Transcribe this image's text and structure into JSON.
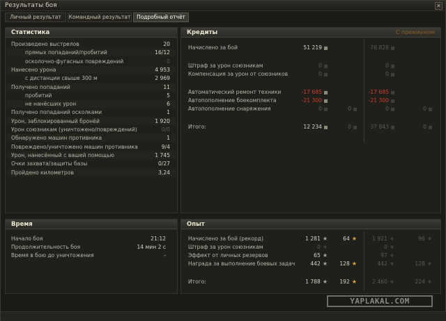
{
  "window": {
    "title": "Результаты боя",
    "close_icon": "close-icon"
  },
  "tabs": [
    {
      "label": "Личный результат",
      "active": false
    },
    {
      "label": "Командный результат",
      "active": false
    },
    {
      "label": "Подробный отчёт",
      "active": true
    }
  ],
  "stats": {
    "title": "Статистика",
    "rows": [
      {
        "label": "Произведено выстрелов",
        "value": "20"
      },
      {
        "label": "прямых попаданий/пробитий",
        "value": "16/12",
        "indent": true
      },
      {
        "label": "осколочно-фугасных повреждений",
        "value": "0",
        "indent": true,
        "dim": true
      },
      {
        "label": "Нанесено урона",
        "value": "4 953"
      },
      {
        "label": "с дистанции свыше 300 м",
        "value": "2 969",
        "indent": true
      },
      {
        "label": "Получено попаданий",
        "value": "11"
      },
      {
        "label": "пробитий",
        "value": "5",
        "indent": true
      },
      {
        "label": "не нанёсших урон",
        "value": "6",
        "indent": true
      },
      {
        "label": "Получено попаданий осколками",
        "value": "1"
      },
      {
        "label": "Урон, заблокированный бронёй",
        "value": "1 920"
      },
      {
        "label": "Урон союзникам (уничтожено/повреждений)",
        "value": "0/0",
        "dim": true
      },
      {
        "label": "Обнаружено машин противника",
        "value": "1"
      },
      {
        "label": "Повреждено/уничтожено машин противника",
        "value": "9/4"
      },
      {
        "label": "Урон, нанесённый с вашей помощью",
        "value": "1 745"
      },
      {
        "label": "Очки захвата/защиты базы",
        "value": "0/27"
      },
      {
        "label": "Пройдено километров",
        "value": "3,24"
      }
    ]
  },
  "credits": {
    "title": "Кредиты",
    "premium_label": "С премиумом",
    "rows": [
      {
        "label": "Начислено за бой",
        "c1": "51 219",
        "c2": "",
        "p1": "76 828",
        "p2": "",
        "pdim": true
      },
      {
        "label": "Штраф за урон союзникам",
        "c1": "0",
        "c1dim": true,
        "c2": "",
        "p1": "0",
        "p2": "",
        "pdim": true
      },
      {
        "label": "Компенсация за урон от союзников",
        "c1": "0",
        "c1dim": true,
        "c2": "",
        "p1": "0",
        "p2": "",
        "pdim": true
      },
      {
        "label": "Автоматический ремонт техники",
        "c1": "-17 685",
        "red": true,
        "c2": "",
        "p1": "-17 685",
        "p2": "",
        "pdim": true,
        "pred": true
      },
      {
        "label": "Автопополнение боекомплекта",
        "c1": "-21 300",
        "red": true,
        "c2": "",
        "p1": "-21 300",
        "p2": "",
        "pdim": true,
        "pred": true
      },
      {
        "label": "Автопополнение снаряжения",
        "c1": "0",
        "c1dim": true,
        "c2": "0",
        "p1": "0",
        "p2": "0",
        "pdim": true
      },
      {
        "label": "Итого:",
        "c1": "12 234",
        "c2": "0",
        "p1": "37 843",
        "p2": "0",
        "pdim": true
      }
    ]
  },
  "time": {
    "title": "Время",
    "rows": [
      {
        "label": "Начало боя",
        "value": "21:12"
      },
      {
        "label": "Продолжительность боя",
        "value": "14 мин 2 с"
      },
      {
        "label": "Время в бою до уничтожения",
        "value": "-"
      }
    ]
  },
  "experience": {
    "title": "Опыт",
    "rows": [
      {
        "label": "Начислено за бой (рекорд)",
        "x1": "1 281",
        "x2": "64",
        "p1": "1 921",
        "p2": "96"
      },
      {
        "label": "Штраф за урон союзникам",
        "x1": "0",
        "x2": "",
        "p1": "0",
        "p2": "",
        "x1dim": true
      },
      {
        "label": "Эффект от личных резервов",
        "x1": "65",
        "x2": "",
        "p1": "97",
        "p2": ""
      },
      {
        "label": "Награда за выполнение боевых задач",
        "x1": "442",
        "x2": "128",
        "p1": "442",
        "p2": "128"
      },
      {
        "label": "Итого:",
        "x1": "1 788",
        "x2": "192",
        "p1": "2 460",
        "p2": "224"
      }
    ]
  },
  "watermark": "YAPLAKAL.COM",
  "colors": {
    "red": "#d43a2a",
    "gold": "#e7a33d",
    "panel_bg": "#1f1f1c"
  }
}
